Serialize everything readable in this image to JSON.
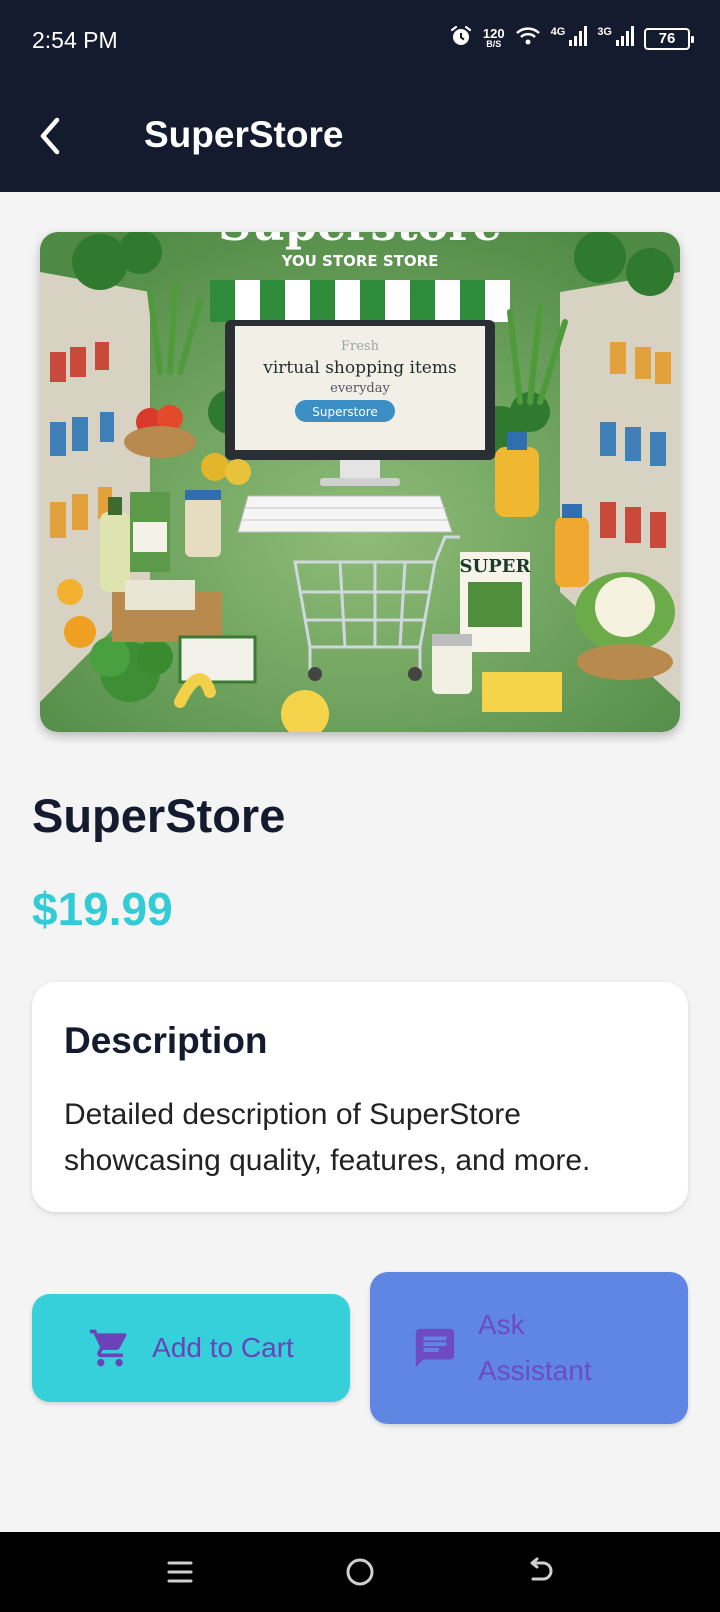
{
  "status_bar": {
    "time": "2:54 PM",
    "net_speed_value": "120",
    "net_speed_unit": "B/S",
    "signal1_label": "4G",
    "signal2_label": "3G",
    "battery_level": "76",
    "icons": [
      "alarm-icon",
      "wifi-icon",
      "signal-icon",
      "battery-icon"
    ]
  },
  "app_bar": {
    "title": "SuperStore",
    "back_icon": "chevron-left-icon"
  },
  "hero_image": {
    "banner_text": "Superstore",
    "sub_text": "YOU STORE  STORE",
    "screen_line1": "Fresh",
    "screen_line2": "virtual shopping items",
    "screen_line3": "everyday",
    "screen_button": "Superstore",
    "bag_label": "SUPER"
  },
  "product": {
    "name": "SuperStore",
    "price": "$19.99"
  },
  "description": {
    "heading": "Description",
    "text": "Detailed description of SuperStore showcasing quality, features, and more."
  },
  "actions": {
    "add_to_cart": "Add to Cart",
    "ask_assistant": "Ask Assistant"
  },
  "colors": {
    "header_bg": "#141b2e",
    "accent_cyan": "#33ccd6",
    "assistant_blue": "#5f86e3",
    "button_text_purple": "#6a43b8"
  }
}
